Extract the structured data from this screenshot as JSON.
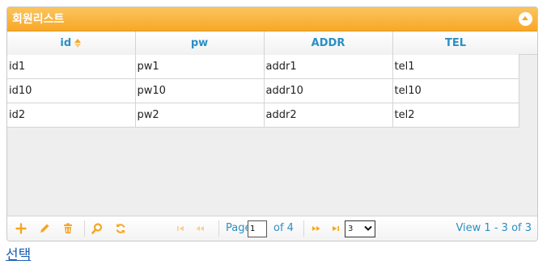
{
  "grid": {
    "caption": "회원리스트",
    "columns": [
      "id",
      "pw",
      "ADDR",
      "TEL"
    ],
    "rows": [
      [
        "id1",
        "pw1",
        "addr1",
        "tel1"
      ],
      [
        "id10",
        "pw10",
        "addr10",
        "tel10"
      ],
      [
        "id2",
        "pw2",
        "addr2",
        "tel2"
      ]
    ],
    "sorted_column": "id",
    "sort_order": "ascending"
  },
  "pager": {
    "page_label": "Page",
    "page_value": "1",
    "of_label": "of 4",
    "rows_per_page": "3",
    "record_info": "View 1 - 3 of 3"
  },
  "colors": {
    "caption_bg": "#f7a826",
    "header_text": "#2b8fc4",
    "icon_orange": "#f5a623"
  },
  "link": {
    "label": "선택"
  }
}
